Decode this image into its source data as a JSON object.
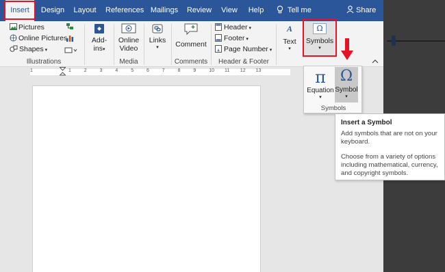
{
  "tabs": [
    {
      "label": "Insert",
      "active": true
    },
    {
      "label": "Design"
    },
    {
      "label": "Layout"
    },
    {
      "label": "References"
    },
    {
      "label": "Mailings"
    },
    {
      "label": "Review"
    },
    {
      "label": "View"
    },
    {
      "label": "Help"
    }
  ],
  "tell_me": {
    "label": "Tell me",
    "icon": "lightbulb-icon"
  },
  "share": {
    "label": "Share",
    "icon": "person-icon"
  },
  "ribbon": {
    "illustrations": {
      "group_label": "Illustrations",
      "pictures": "Pictures",
      "online_pictures": "Online Pictures",
      "shapes": "Shapes"
    },
    "addins": {
      "label_line1": "Add-",
      "label_line2": "ins"
    },
    "media": {
      "group_label": "Media",
      "online_video_line1": "Online",
      "online_video_line2": "Video"
    },
    "links": {
      "label": "Links"
    },
    "comments": {
      "group_label": "Comments",
      "comment": "Comment"
    },
    "header_footer": {
      "group_label": "Header & Footer",
      "header": "Header",
      "footer": "Footer",
      "page_number": "Page Number"
    },
    "text": {
      "label": "Text"
    },
    "symbols": {
      "label": "Symbols",
      "symbol_glyph": "Ω"
    }
  },
  "symbols_panel": {
    "equation": "Equation",
    "equation_glyph": "π",
    "symbol": "Symbol",
    "symbol_glyph": "Ω",
    "group_label": "Symbols"
  },
  "tooltip": {
    "title": "Insert a Symbol",
    "line1": "Add symbols that are not on your keyboard.",
    "line2": "Choose from a variety of options including mathematical, currency, and copyright symbols."
  },
  "ruler": {
    "left_mark": "1",
    "numbers": [
      "1",
      "2",
      "3",
      "4",
      "5",
      "6",
      "7",
      "8",
      "9",
      "10",
      "11",
      "12",
      "13"
    ]
  },
  "colors": {
    "brand": "#2b579a",
    "highlight": "#e81123"
  }
}
